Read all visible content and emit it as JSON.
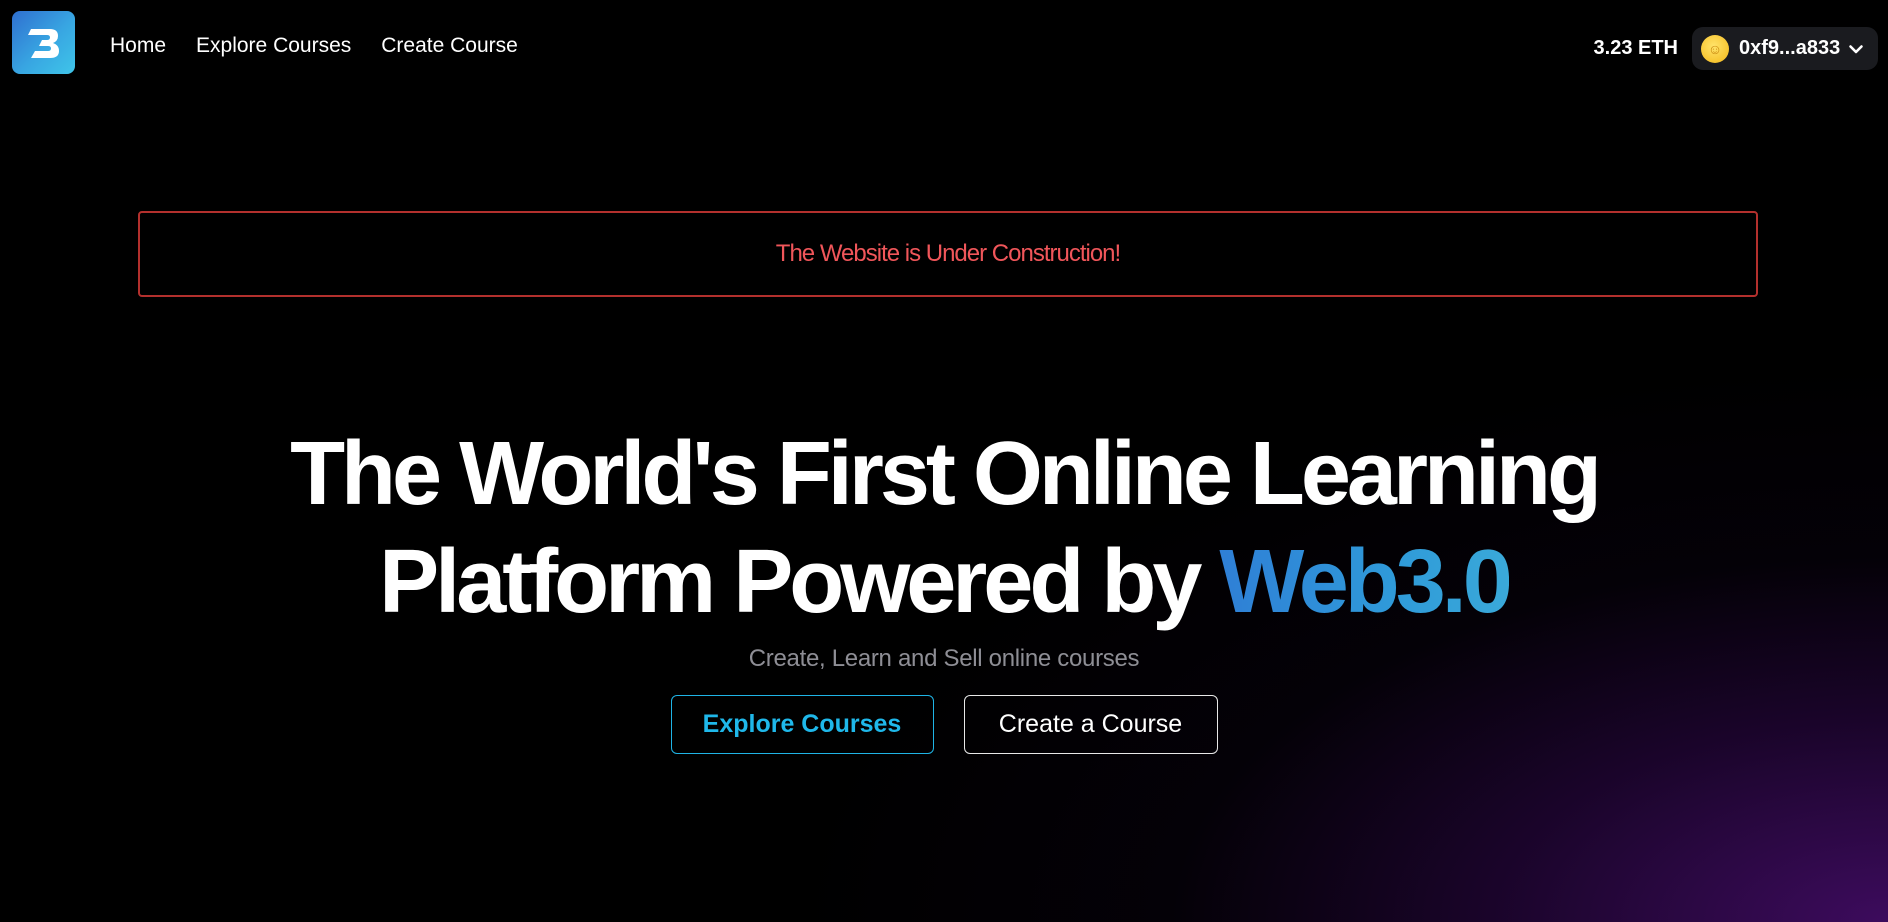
{
  "brand": {
    "logo_icon": "b-letter-logo-icon",
    "logo_gradient": [
      "#2f6fd0",
      "#3fc5e9"
    ]
  },
  "nav": {
    "items": [
      {
        "label": "Home"
      },
      {
        "label": "Explore Courses"
      },
      {
        "label": "Create Course"
      }
    ]
  },
  "wallet": {
    "balance": "3.23 ETH",
    "address": "0xf9...a833",
    "avatar_icon": "emoji-avatar-icon",
    "chevron_icon": "chevron-down-icon"
  },
  "alert": {
    "message": "The Website is Under Construction!",
    "color": "#f0565a",
    "border_color": "#b3302d"
  },
  "hero": {
    "title_line1": "The World's First Online Learning",
    "title_line2_prefix": "Platform Powered by ",
    "title_accent": "Web3.0",
    "subtitle": "Create, Learn and Sell online courses",
    "primary_button": "Explore Courses",
    "secondary_button": "Create a Course",
    "accent_color": "#2f9ad9"
  }
}
